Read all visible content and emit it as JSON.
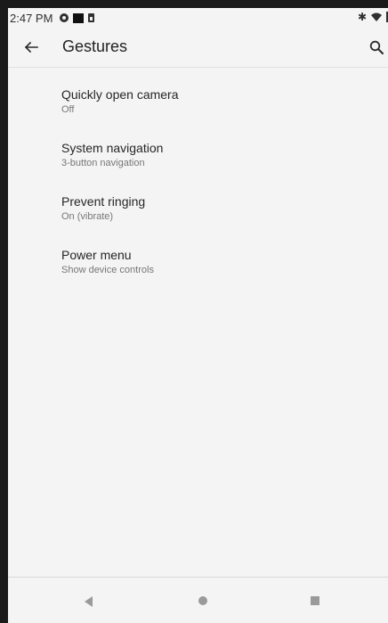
{
  "status_bar": {
    "time": "2:47 PM",
    "icons": [
      "app-notification-icon",
      "stop-icon",
      "sim-icon",
      "bluetooth-icon",
      "wifi-icon",
      "battery-icon"
    ]
  },
  "app_bar": {
    "title": "Gestures",
    "back_icon": "arrow-back-icon",
    "search_icon": "search-icon"
  },
  "settings": {
    "items": [
      {
        "title": "Quickly open camera",
        "summary": "Off"
      },
      {
        "title": "System navigation",
        "summary": "3-button navigation"
      },
      {
        "title": "Prevent ringing",
        "summary": "On (vibrate)"
      },
      {
        "title": "Power menu",
        "summary": "Show device controls"
      }
    ]
  },
  "nav_bar": {
    "icons": [
      "nav-back-icon",
      "nav-home-icon",
      "nav-recents-icon"
    ]
  }
}
